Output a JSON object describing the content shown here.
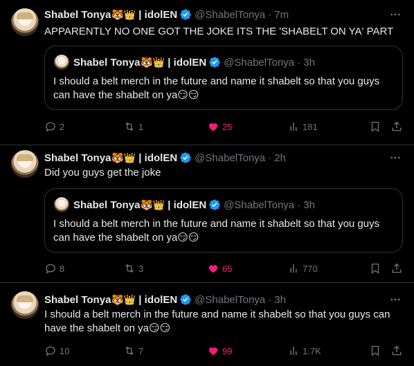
{
  "colors": {
    "background": "#000000",
    "text": "#e7e9ea",
    "muted": "#71767b",
    "like": "#f91880",
    "verified": "#1d9bf0",
    "border": "#2f3336"
  },
  "tweets": [
    {
      "author": {
        "name": "Shabel Tonya",
        "emojis": "🐯👑",
        "suffix": "| idolEN",
        "handle": "@ShabelTonya",
        "time": "· 7m"
      },
      "text": "APPARENTLY NO ONE GOT THE JOKE ITS THE 'SHABELT ON YA' PART",
      "quote": {
        "author": {
          "name": "Shabel Tonya",
          "emojis": "🐯👑",
          "suffix": "| idolEN",
          "handle": "@ShabelTonya",
          "time": "· 3h"
        },
        "line1": "I should a belt merch in the future and name it shabelt so that you guys",
        "line2": "can have the shabelt on ya😏😏"
      },
      "stats": {
        "replies": "2",
        "retweets": "1",
        "likes": "25",
        "views": "181"
      }
    },
    {
      "author": {
        "name": "Shabel Tonya",
        "emojis": "🐯👑",
        "suffix": "| idolEN",
        "handle": "@ShabelTonya",
        "time": "· 2h"
      },
      "text": "Did you guys get the joke",
      "quote": {
        "author": {
          "name": "Shabel Tonya",
          "emojis": "🐯👑",
          "suffix": "| idolEN",
          "handle": "@ShabelTonya",
          "time": "· 3h"
        },
        "line1": "I should a belt merch in the future and name it shabelt so that you guys",
        "line2": "can have the shabelt on ya😏😏"
      },
      "stats": {
        "replies": "8",
        "retweets": "3",
        "likes": "65",
        "views": "770"
      }
    },
    {
      "author": {
        "name": "Shabel Tonya",
        "emojis": "🐯👑",
        "suffix": "| idolEN",
        "handle": "@ShabelTonya",
        "time": "· 3h"
      },
      "line1": "I should a belt merch in the future and name it shabelt so that you guys can",
      "line2": "have the shabelt on ya😏😏",
      "stats": {
        "replies": "10",
        "retweets": "7",
        "likes": "99",
        "views": "1.7K"
      }
    }
  ]
}
